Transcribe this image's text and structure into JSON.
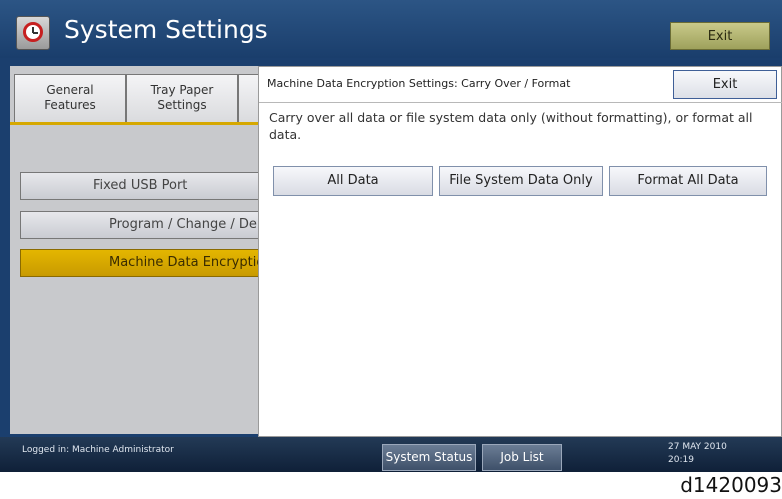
{
  "app": {
    "title": "System Settings",
    "exit_label": "Exit"
  },
  "tabs": [
    {
      "label": "General\nFeatures"
    },
    {
      "label": "Tray Paper\nSettings"
    }
  ],
  "menu": [
    {
      "label": "Fixed USB Port"
    },
    {
      "label": "Program / Change / Dele"
    },
    {
      "label": "Machine Data Encryption"
    }
  ],
  "dialog": {
    "title": "Machine Data Encryption Settings: Carry Over / Format",
    "exit_label": "Exit",
    "message": "Carry over all data or file system data only (without formatting), or format all data.",
    "options": [
      {
        "label": "All Data"
      },
      {
        "label": "File System Data Only"
      },
      {
        "label": "Format All Data"
      }
    ]
  },
  "status": {
    "logged_in": "Logged in: Machine Administrator",
    "system_status_label": "System Status",
    "job_list_label": "Job List",
    "date": "27 MAY  2010",
    "time": "20:19"
  },
  "figure_code": "d1420093"
}
